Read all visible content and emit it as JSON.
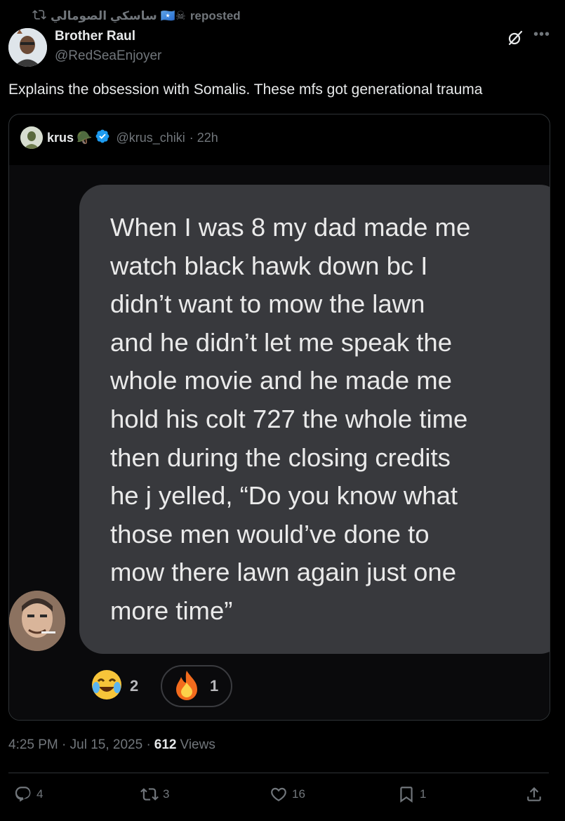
{
  "repost": {
    "user": "ساسكي الصومالي 🇸🇴☠",
    "label": "reposted"
  },
  "author": {
    "name": "Brother Raul",
    "handle": "@RedSeaEnjoyer"
  },
  "tweet": {
    "text": "Explains the obsession with Somalis. These mfs got generational trauma"
  },
  "quoted": {
    "name": "krus",
    "badge_emoji": "🪖",
    "handle": "@krus_chiki",
    "time": "· 22h",
    "message": "When I was 8 my dad made me\nwatch black hawk down bc I\ndidn’t want to mow the lawn\nand he didn’t let me speak the\nwhole movie and he made me\nhold his colt 727 the whole time\nthen during the closing credits\nhe j yelled, “Do you know what\nthose men would’ve done to\nmow there lawn again just one\nmore time”",
    "reactions": [
      {
        "emoji": "😂",
        "count": "2"
      },
      {
        "emoji": "🔥",
        "count": "1"
      }
    ]
  },
  "meta": {
    "time": "4:25 PM · Jul 15, 2025 ·",
    "views_count": "612",
    "views_label": "Views"
  },
  "actions": {
    "replies": "4",
    "reposts": "3",
    "likes": "16",
    "bookmarks": "1"
  },
  "colors": {
    "background": "#000000",
    "muted": "#71767b",
    "text": "#e7e9ea",
    "verified": "#1d9bf0",
    "bubble": "#38393d"
  }
}
